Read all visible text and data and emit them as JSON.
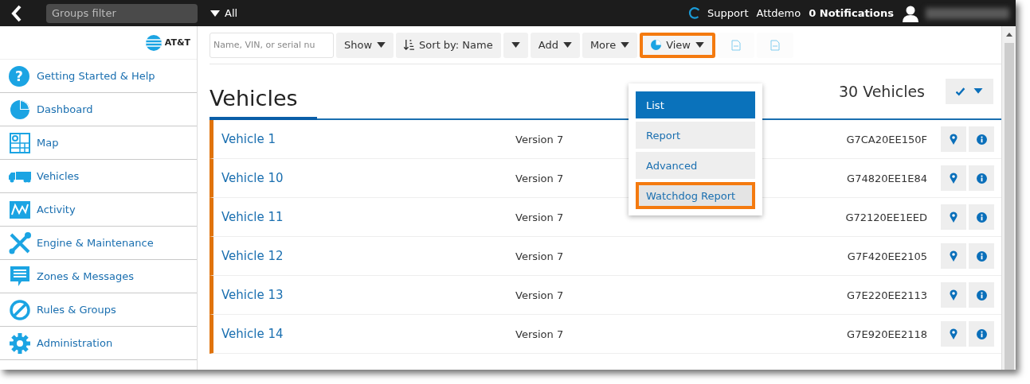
{
  "topbar": {
    "filter_placeholder": "Groups filter",
    "group": "All",
    "support": "Support",
    "user": "Attdemo",
    "notifications": "0 Notifications"
  },
  "sidebar": {
    "logo": "AT&T",
    "items": [
      {
        "label": "Getting Started & Help",
        "kind": "help",
        "icon": "?"
      },
      {
        "label": "Dashboard",
        "kind": "pie"
      },
      {
        "label": "Map",
        "kind": "map"
      },
      {
        "label": "Vehicles",
        "kind": "truck"
      },
      {
        "label": "Activity",
        "kind": "activity"
      },
      {
        "label": "Engine & Maintenance",
        "kind": "tools"
      },
      {
        "label": "Zones & Messages",
        "kind": "message"
      },
      {
        "label": "Rules & Groups",
        "kind": "ban"
      },
      {
        "label": "Administration",
        "kind": "gear"
      }
    ]
  },
  "toolbar": {
    "search_placeholder": "Name, VIN, or serial nu",
    "buttons": [
      {
        "kind": "menu",
        "label": "Show",
        "highlighted": false,
        "disabled": false
      },
      {
        "kind": "sort",
        "label": "Sort by: Name",
        "highlighted": false,
        "disabled": false
      },
      {
        "kind": "caret",
        "highlighted": false,
        "disabled": false
      },
      {
        "kind": "menu",
        "label": "Add",
        "highlighted": false,
        "disabled": false
      },
      {
        "kind": "menu",
        "label": "More",
        "highlighted": false,
        "disabled": false
      },
      {
        "kind": "view",
        "label": "View",
        "highlighted": true,
        "disabled": false
      },
      {
        "kind": "export",
        "highlighted": false,
        "disabled": true
      },
      {
        "kind": "export",
        "highlighted": false,
        "disabled": true
      }
    ]
  },
  "view_menu": [
    {
      "label": "List",
      "selected": true,
      "highlighted": false
    },
    {
      "label": "Report",
      "selected": false,
      "highlighted": false
    },
    {
      "label": "Advanced",
      "selected": false,
      "highlighted": false
    },
    {
      "label": "Watchdog Report",
      "selected": false,
      "highlighted": true
    }
  ],
  "page": {
    "title": "Vehicles",
    "count": "30 Vehicles"
  },
  "rows": [
    {
      "name": "Vehicle 1",
      "version": "Version 7",
      "serial": "G7CA20EE150F"
    },
    {
      "name": "Vehicle 10",
      "version": "Version 7",
      "serial": "G74820EE1E84"
    },
    {
      "name": "Vehicle 11",
      "version": "Version 7",
      "serial": "G72120EE1EED"
    },
    {
      "name": "Vehicle 12",
      "version": "Version 7",
      "serial": "G7F420EE2105"
    },
    {
      "name": "Vehicle 13",
      "version": "Version 7",
      "serial": "G7E220EE2113"
    },
    {
      "name": "Vehicle 14",
      "version": "Version 7",
      "serial": "G7E920EE2118"
    }
  ]
}
